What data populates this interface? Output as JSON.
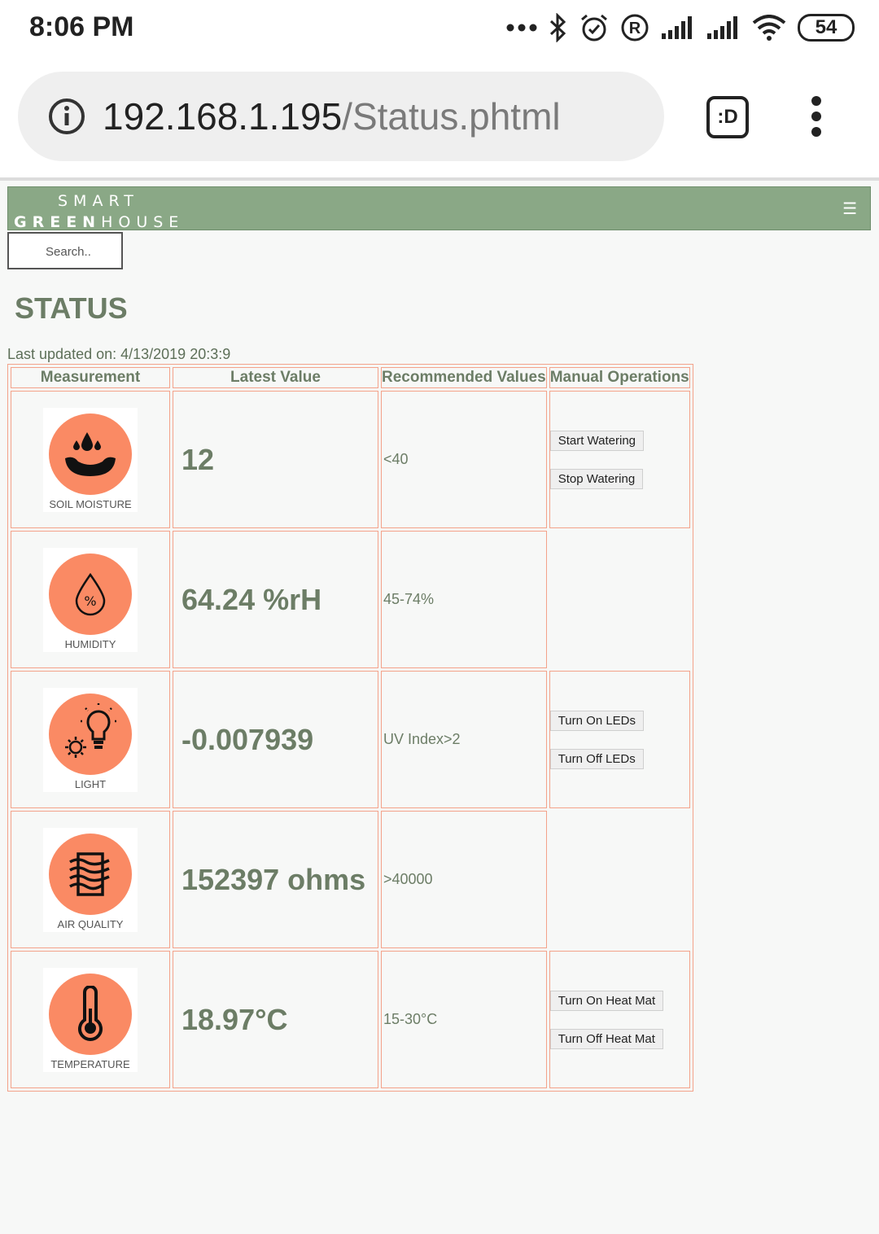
{
  "statusbar": {
    "time": "8:06 PM",
    "icons": [
      "more-dots-icon",
      "bluetooth-icon",
      "alarm-icon",
      "registered-icon",
      "signal-icon",
      "signal-icon",
      "wifi-icon"
    ],
    "battery": "54"
  },
  "browser": {
    "url_host": "192.168.1.195",
    "url_path": "/Status.phtml",
    "tab_label": ":D"
  },
  "site": {
    "logo_line1": "SMART",
    "logo_line2a": "GREEN",
    "logo_line2b": "HOUSE",
    "menu_glyph": "☰",
    "search_placeholder": "Search..",
    "title": "STATUS",
    "updated_label": "Last updated on: 4/13/2019 20:3:9"
  },
  "table": {
    "headers": [
      "Measurement",
      "Latest Value",
      "Recommended Values",
      "Manual Operations"
    ],
    "rows": [
      {
        "label": "SOIL MOISTURE",
        "icon": "soil-moisture-icon",
        "value": "12",
        "recommended": "<40",
        "ops": [
          "Start Watering",
          "Stop Watering"
        ]
      },
      {
        "label": "HUMIDITY",
        "icon": "humidity-icon",
        "value": "64.24 %rH",
        "recommended": "45-74%",
        "ops": []
      },
      {
        "label": "LIGHT",
        "icon": "light-bulb-icon",
        "value": "-0.007939",
        "recommended": "UV Index>2",
        "ops": [
          "Turn On LEDs",
          "Turn Off LEDs"
        ]
      },
      {
        "label": "AIR QUALITY",
        "icon": "air-quality-icon",
        "value": "152397 ohms",
        "recommended": ">40000",
        "ops": []
      },
      {
        "label": "TEMPERATURE",
        "icon": "thermometer-icon",
        "value": "18.97°C",
        "recommended": "15-30°C",
        "ops": [
          "Turn On Heat Mat",
          "Turn Off Heat Mat"
        ]
      }
    ]
  },
  "colors": {
    "header_bg": "#8aa886",
    "accent": "#fa8a64",
    "table_border": "#f3a28a",
    "text": "#6c7d66"
  }
}
